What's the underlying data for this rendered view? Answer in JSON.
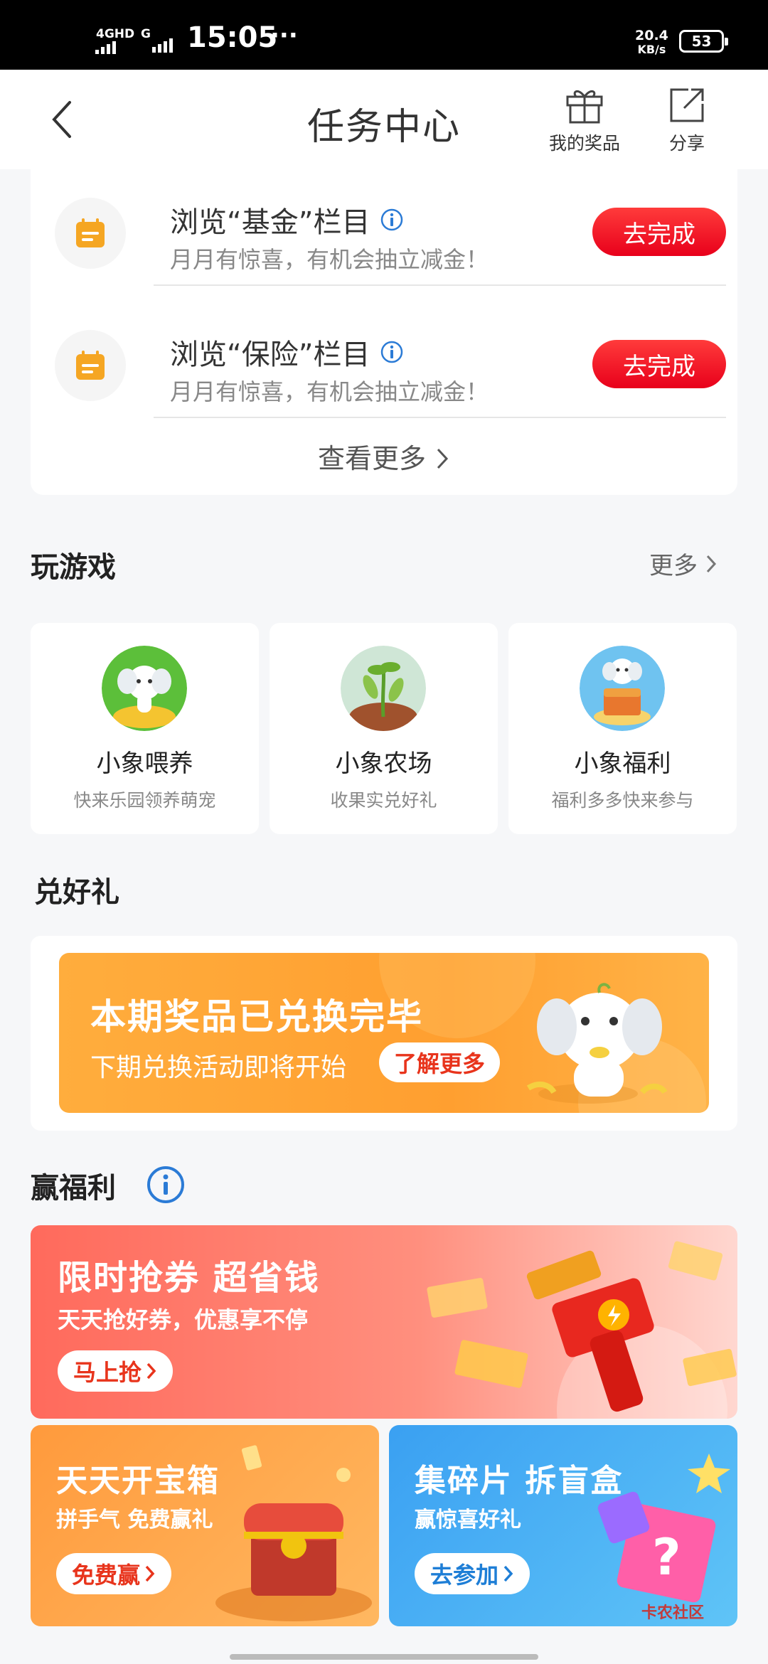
{
  "status_bar": {
    "network1": "4GHD",
    "network2": "G",
    "time": "15:05",
    "dots": "···",
    "speed": "20.4",
    "speed_unit": "KB/s",
    "battery": "53"
  },
  "header": {
    "title": "任务中心",
    "prizes_label": "我的奖品",
    "share_label": "分享"
  },
  "tasks": [
    {
      "title": "浏览“基金”栏目",
      "subtitle": "月月有惊喜，有机会抽立减金！",
      "button": "去完成"
    },
    {
      "title": "浏览“保险”栏目",
      "subtitle": "月月有惊喜，有机会抽立减金！",
      "button": "去完成"
    }
  ],
  "see_more": "查看更多",
  "games": {
    "title": "玩游戏",
    "more": "更多",
    "items": [
      {
        "name": "小象喂养",
        "desc": "快来乐园领养萌宠"
      },
      {
        "name": "小象农场",
        "desc": "收果实兑好礼"
      },
      {
        "name": "小象福利",
        "desc": "福利多多快来参与"
      }
    ]
  },
  "redeem": {
    "title": "兑好礼",
    "banner_title": "本期奖品已兑换完毕",
    "banner_sub": "下期兑换活动即将开始",
    "banner_button": "了解更多"
  },
  "welfare": {
    "title": "赢福利",
    "big": {
      "title": "限时抢券 超省钱",
      "sub": "天天抢好券，优惠享不停",
      "button": "马上抢"
    },
    "left": {
      "title": "天天开宝箱",
      "sub": "拼手气 免费赢礼",
      "button": "免费赢"
    },
    "right": {
      "title": "集碎片 拆盲盒",
      "sub": "赢惊喜好礼",
      "button": "去参加"
    }
  },
  "watermark": "卡农社区",
  "colors": {
    "accent_red": "#e8001b",
    "task_icon": "#f5a623",
    "info_blue": "#2b7bd6"
  }
}
